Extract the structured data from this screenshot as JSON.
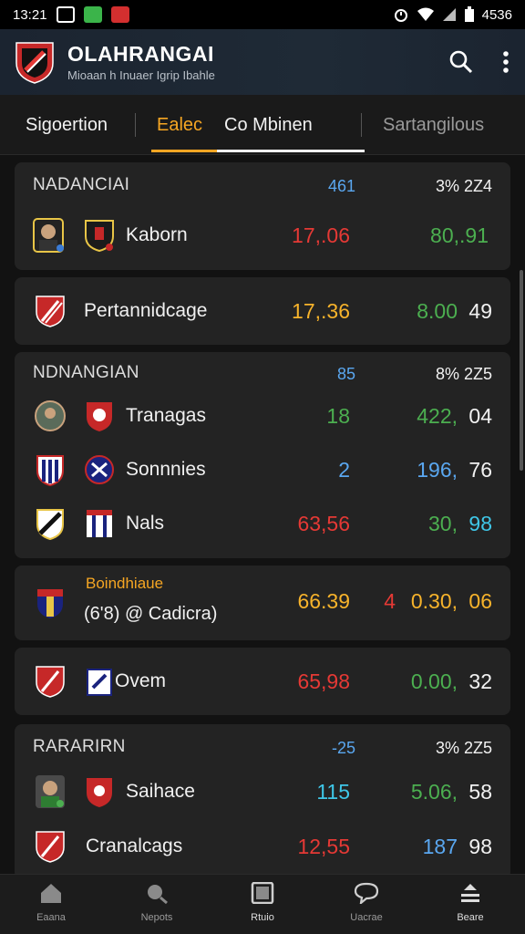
{
  "status_bar": {
    "time": "13:21",
    "battery": "4536",
    "colors": {
      "app_icon_green": "#3bb44a",
      "app_icon_red": "#d32f2f"
    }
  },
  "header": {
    "title": "OLAHRANGAI",
    "subtitle": "Mioaan h Inuaer Igrip Ibahle",
    "actions": [
      "search-icon",
      "more-vert-icon"
    ]
  },
  "tabs": [
    {
      "label": "Sigoertion"
    },
    {
      "label": "Ealec",
      "active": true
    },
    {
      "label": "Co Mbinen"
    },
    {
      "label": "Sartangilous"
    }
  ],
  "sections": [
    {
      "title": "NADANCIAI",
      "col_a": "461",
      "col_b": "3%",
      "col_c": "2Z4",
      "rows": [
        {
          "team": "Kaborn",
          "value_a": "17,.06",
          "value_b": "80,.91"
        }
      ]
    },
    {
      "rows": [
        {
          "team": "Pertannidcage",
          "value_a": "17,.36",
          "value_b": "8.00",
          "value_c": "49"
        }
      ]
    },
    {
      "title": "NDNANGIAN",
      "col_a": "85",
      "col_b": "8%",
      "col_c": "2Z5",
      "rows": [
        {
          "team": "Tranagas",
          "value_a": "18",
          "value_b": "422,",
          "value_c": "04"
        },
        {
          "team": "Sonnnies",
          "value_a": "2",
          "value_b": "196,",
          "value_c": "76"
        },
        {
          "team": "Nals",
          "value_a": "63,56",
          "value_b": "30,",
          "value_c": "98"
        }
      ]
    },
    {
      "title": "Boindhiaue",
      "subtitle": "(6'8) @ Cadicra)",
      "rows": [
        {
          "value_a": "66.39",
          "marker": "4",
          "value_b": "0.30,",
          "value_c": "06"
        }
      ]
    },
    {
      "rows": [
        {
          "team": "Ovem",
          "value_a": "65,98",
          "value_b": "0.00,",
          "value_c": "32"
        }
      ]
    },
    {
      "title": "RARARIRN",
      "col_a": "-25",
      "col_b": "3%",
      "col_c": "2Z5",
      "rows": [
        {
          "team": "Saihace",
          "value_a": "115",
          "value_b": "5.06,",
          "value_c": "58"
        },
        {
          "team": "Cranalcags",
          "value_a": "12,55",
          "value_b": "187",
          "value_c": "98"
        }
      ]
    }
  ],
  "bottom_nav": [
    {
      "label": "Eaana",
      "icon": "home-icon"
    },
    {
      "label": "Nepots",
      "icon": "search-icon"
    },
    {
      "label": "Rtuio",
      "icon": "square-icon"
    },
    {
      "label": "Uacrae",
      "icon": "chat-bubble-icon"
    },
    {
      "label": "Beare",
      "icon": "download-tray-icon"
    }
  ],
  "colors": {
    "accent": "#f6a623",
    "red": "#e53935",
    "green": "#4caf50",
    "blue": "#5aa7f0",
    "yellow": "#f7b32b",
    "cyan": "#3fc7e8"
  }
}
